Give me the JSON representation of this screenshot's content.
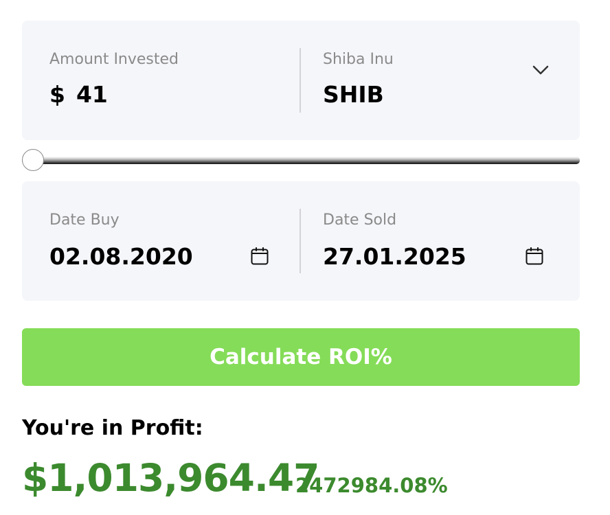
{
  "investment": {
    "amount_label": "Amount Invested",
    "currency_symbol": "$",
    "amount_value": "41",
    "slider_level": 0
  },
  "coin": {
    "name": "Shiba Inu",
    "ticker": "SHIB",
    "dropdown_icon": "chevron-down-icon"
  },
  "dates": {
    "buy_label": "Date Buy",
    "buy_value": "02.08.2020",
    "sold_label": "Date Sold",
    "sold_value": "27.01.2025",
    "calendar_icon": "calendar-icon"
  },
  "action": {
    "calculate_label": "Calculate ROI%"
  },
  "result": {
    "heading": "You're in Profit:",
    "amount": "$1,013,964.47",
    "percent": "2472984.08%"
  },
  "colors": {
    "card_background": "#f5f6fa",
    "button_green": "#85dc58",
    "profit_green": "#3c8a2e"
  }
}
